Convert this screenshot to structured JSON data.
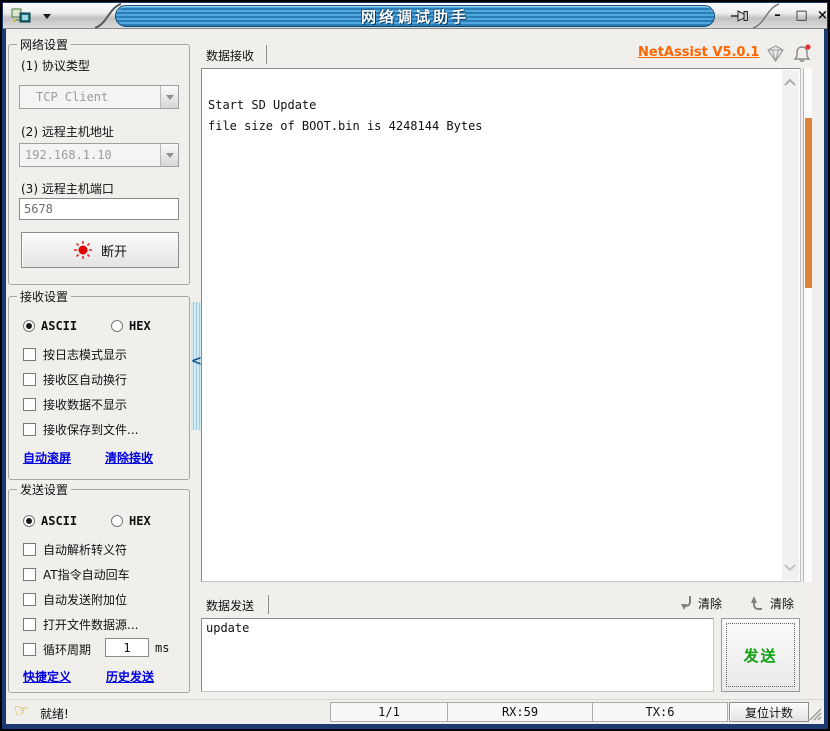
{
  "window": {
    "title": "网络调试助手",
    "minimize_glyph": "–",
    "maximize_glyph": "□",
    "close_glyph": "×"
  },
  "colors": {
    "title_bar_blue": "#2B7CB4",
    "frame_navy": "#1B3A70",
    "version_orange": "#FF6600",
    "send_button_green": "#0FA00F",
    "link_blue": "#0000E0",
    "scroll_thumb_orange": "#E0823C",
    "disconnect_dot_red": "#E00000"
  },
  "network_settings": {
    "title": "网络设置",
    "protocol_label": "(1) 协议类型",
    "protocol_value": "TCP Client",
    "host_label": "(2) 远程主机地址",
    "host_value": "192.168.1.10",
    "port_label": "(3) 远程主机端口",
    "port_value": "5678",
    "disconnect_label": "断开"
  },
  "receive_settings": {
    "title": "接收设置",
    "ascii_label": "ASCII",
    "hex_label": "HEX",
    "checkboxes": [
      "按日志模式显示",
      "接收区自动换行",
      "接收数据不显示",
      "接收保存到文件..."
    ],
    "links": [
      "自动滚屏",
      "清除接收"
    ]
  },
  "send_settings": {
    "title": "发送设置",
    "ascii_label": "ASCII",
    "hex_label": "HEX",
    "checkboxes": [
      "自动解析转义符",
      "AT指令自动回车",
      "自动发送附加位",
      "打开文件数据源..."
    ],
    "cycle_label": "循环周期",
    "cycle_value": "1",
    "cycle_unit": "ms",
    "links": [
      "快捷定义",
      "历史发送"
    ]
  },
  "receive_area": {
    "tab_label": "数据接收",
    "version_link": "NetAssist V5.0.1",
    "content": "Start SD Update\nfile size of BOOT.bin is 4248144 Bytes"
  },
  "send_area": {
    "tab_label": "数据发送",
    "clear_receive_label": "清除",
    "clear_send_label": "清除",
    "input_value": "update",
    "send_button_label": "发送"
  },
  "status_bar": {
    "ready_text": "就绪!",
    "page_indicator": "1/1",
    "rx_counter": "RX:59",
    "tx_counter": "TX:6",
    "reset_button_label": "复位计数"
  }
}
